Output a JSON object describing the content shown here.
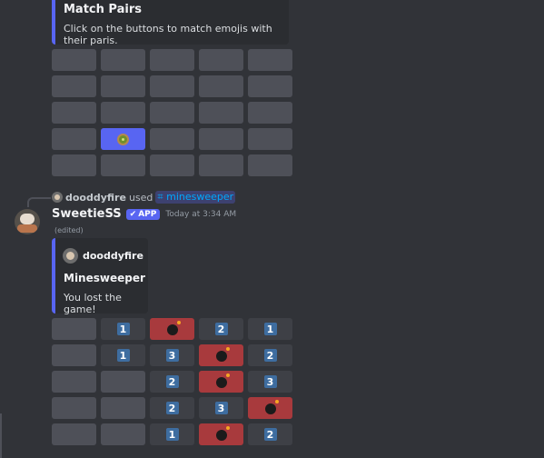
{
  "match_pairs": {
    "title": "Match Pairs",
    "description": "Click on the buttons to match emojis with their paris.",
    "grid": [
      [
        {
          "state": "hidden"
        },
        {
          "state": "hidden"
        },
        {
          "state": "hidden"
        },
        {
          "state": "hidden"
        },
        {
          "state": "hidden"
        }
      ],
      [
        {
          "state": "hidden"
        },
        {
          "state": "hidden"
        },
        {
          "state": "hidden"
        },
        {
          "state": "hidden"
        },
        {
          "state": "hidden"
        }
      ],
      [
        {
          "state": "hidden"
        },
        {
          "state": "hidden"
        },
        {
          "state": "hidden"
        },
        {
          "state": "hidden"
        },
        {
          "state": "hidden"
        }
      ],
      [
        {
          "state": "hidden"
        },
        {
          "state": "selected",
          "icon": "kiwi-icon"
        },
        {
          "state": "hidden"
        },
        {
          "state": "hidden"
        },
        {
          "state": "hidden"
        }
      ],
      [
        {
          "state": "hidden"
        },
        {
          "state": "hidden"
        },
        {
          "state": "hidden"
        },
        {
          "state": "hidden"
        },
        {
          "state": "hidden"
        }
      ]
    ]
  },
  "command_reply": {
    "user": "dooddyfire",
    "used_text": "used",
    "command": "minesweeper"
  },
  "message": {
    "author": "SweetieSS",
    "badge": "APP",
    "timestamp": "Today at 3:34 AM",
    "edited_label": "(edited)"
  },
  "minesweeper": {
    "author": "dooddyfire",
    "title": "Minesweeper",
    "description": "You lost the game!",
    "grid": [
      [
        {
          "state": "hidden"
        },
        {
          "state": "number",
          "value": "1"
        },
        {
          "state": "bomb"
        },
        {
          "state": "number",
          "value": "2"
        },
        {
          "state": "number",
          "value": "1"
        }
      ],
      [
        {
          "state": "hidden"
        },
        {
          "state": "number",
          "value": "1"
        },
        {
          "state": "number",
          "value": "3"
        },
        {
          "state": "bomb"
        },
        {
          "state": "number",
          "value": "2"
        }
      ],
      [
        {
          "state": "hidden"
        },
        {
          "state": "hidden"
        },
        {
          "state": "number",
          "value": "2"
        },
        {
          "state": "bomb"
        },
        {
          "state": "number",
          "value": "3"
        }
      ],
      [
        {
          "state": "hidden"
        },
        {
          "state": "hidden"
        },
        {
          "state": "number",
          "value": "2"
        },
        {
          "state": "number",
          "value": "3"
        },
        {
          "state": "bomb"
        }
      ],
      [
        {
          "state": "hidden"
        },
        {
          "state": "hidden"
        },
        {
          "state": "number",
          "value": "1"
        },
        {
          "state": "bomb"
        },
        {
          "state": "number",
          "value": "2"
        }
      ]
    ]
  },
  "colors": {
    "accent": "#5865f2",
    "button": "#4e5058",
    "bomb_bg": "#a83a3d",
    "number_bg": "#3e6da0",
    "link": "#00a8fc"
  }
}
